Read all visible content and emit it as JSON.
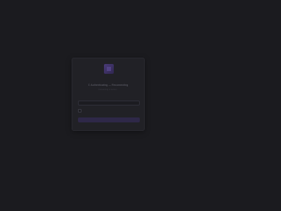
{
  "login": {
    "title": "Σ Authenticating — Reconnecting",
    "subtitle": "Connecting to server...",
    "field_label": "",
    "input_value": "",
    "input_placeholder": "",
    "remember_label": "",
    "submit_label": ""
  },
  "icons": {
    "logo": "app-logo-icon"
  },
  "colors": {
    "background": "#1b1b1f",
    "card": "#212126",
    "accent": "#4a3b78",
    "button": "#2e2848"
  }
}
